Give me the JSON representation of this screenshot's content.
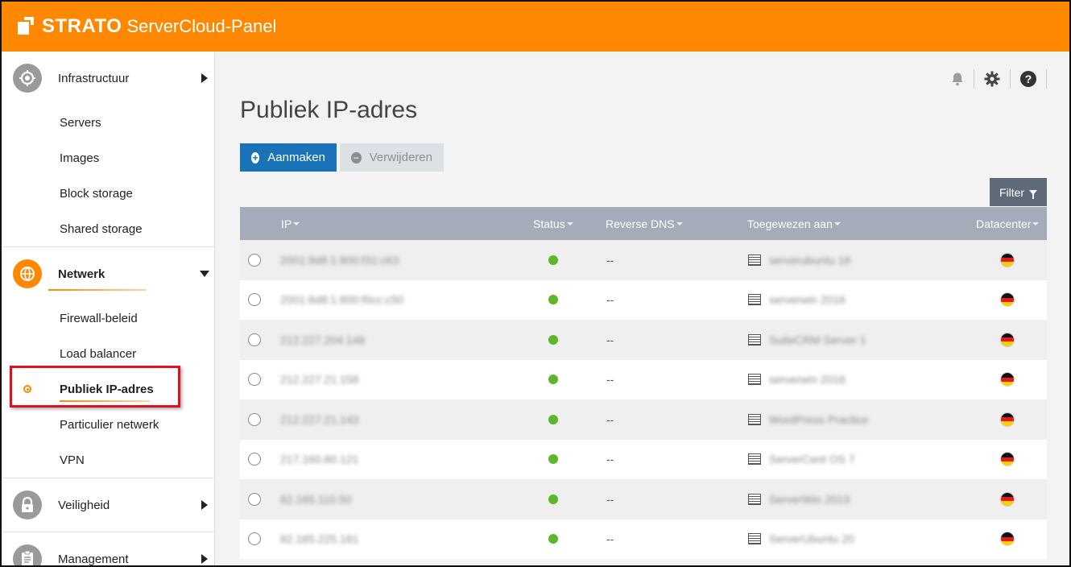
{
  "header": {
    "brand": "STRATO",
    "app_name": "ServerCloud-Panel"
  },
  "sidebar": {
    "sections": [
      {
        "label": "Infrastructuur",
        "icon": "infrastructure-icon",
        "expanded": false,
        "items": [
          "Servers",
          "Images",
          "Block storage",
          "Shared storage"
        ]
      },
      {
        "label": "Netwerk",
        "icon": "network-globe-icon",
        "expanded": true,
        "items": [
          "Firewall-beleid",
          "Load balancer",
          "Publiek IP-adres",
          "Particulier netwerk",
          "VPN"
        ],
        "active_item": "Publiek IP-adres"
      },
      {
        "label": "Veiligheid",
        "icon": "lock-icon",
        "expanded": false
      },
      {
        "label": "Management",
        "icon": "clipboard-icon",
        "expanded": false
      }
    ]
  },
  "toolbar_icons": [
    "bell-icon",
    "gear-icon",
    "help-icon"
  ],
  "page": {
    "title": "Publiek IP-adres",
    "create_label": "Aanmaken",
    "delete_label": "Verwijderen",
    "filter_label": "Filter"
  },
  "table": {
    "columns": [
      "IP",
      "Status",
      "Reverse DNS",
      "Toegewezen aan",
      "Datacenter"
    ],
    "rows": [
      {
        "ip": "2001:8d8:1:800:f31:c63",
        "status": "active",
        "rdns": "--",
        "assigned": "serverubuntu 18",
        "datacenter": "DE"
      },
      {
        "ip": "2001:8d8:1:800:f0cc:c50",
        "status": "active",
        "rdns": "--",
        "assigned": "serverwin 2016",
        "datacenter": "DE"
      },
      {
        "ip": "212.227.204.148",
        "status": "active",
        "rdns": "--",
        "assigned": "SuiteCRM Server 1",
        "datacenter": "DE"
      },
      {
        "ip": "212.227.21.158",
        "status": "active",
        "rdns": "--",
        "assigned": "serverwin 2016",
        "datacenter": "DE"
      },
      {
        "ip": "212.227.21.143",
        "status": "active",
        "rdns": "--",
        "assigned": "WordPress Practice",
        "datacenter": "DE"
      },
      {
        "ip": "217.160.80.121",
        "status": "active",
        "rdns": "--",
        "assigned": "ServerCent OS 7",
        "datacenter": "DE"
      },
      {
        "ip": "82.165.110.50",
        "status": "active",
        "rdns": "--",
        "assigned": "ServerWin 2019",
        "datacenter": "DE"
      },
      {
        "ip": "82.165.225.181",
        "status": "active",
        "rdns": "--",
        "assigned": "ServerUbuntu 20",
        "datacenter": "DE"
      }
    ]
  },
  "colors": {
    "header": "#ff8800",
    "primary_button": "#1a73b8",
    "table_header": "#a3acb8",
    "status_active": "#5cb82a",
    "highlight_box": "#e01020"
  }
}
